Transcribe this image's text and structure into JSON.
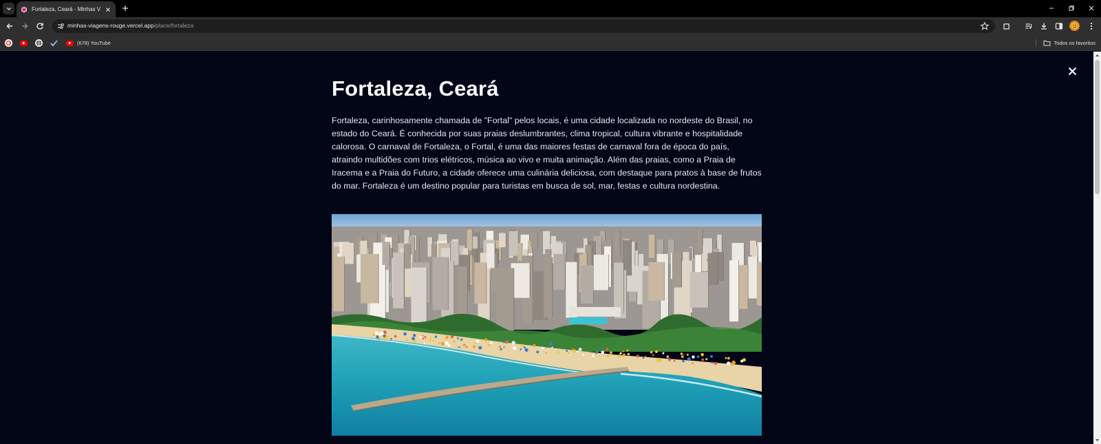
{
  "browser": {
    "tab": {
      "title": "Fortaleza, Ceará - Minhas Viage"
    },
    "url": {
      "host": "minhas-viagens-rouge.vercel.app",
      "path": "/place/fortaleza"
    },
    "bookmarks": {
      "youtube_label": "(678) YouTube",
      "all_bookmarks_label": "Todos os favoritos"
    },
    "colors": {
      "chrome_dark": "#000000",
      "toolbar": "#2f2f2f",
      "omnibox": "#1e1e1e"
    }
  },
  "page": {
    "title": "Fortaleza, Ceará",
    "description": "Fortaleza, carinhosamente chamada de \"Fortal\" pelos locais, é uma cidade localizada no nordeste do Brasil, no estado do Ceará. É conhecida por suas praias deslumbrantes, clima tropical, cultura vibrante e hospitalidade calorosa. O carnaval de Fortaleza, o Fortal, é uma das maiores festas de carnaval fora de época do país, atraindo multidões com trios elétricos, música ao vivo e muita animação. Além das praias, como a Praia de Iracema e a Praia do Futuro, a cidade oferece uma culinária deliciosa, com destaque para pratos à base de frutos do mar. Fortaleza é um destino popular para turistas em busca de sol, mar, festas e cultura nordestina.",
    "colors": {
      "background": "#020617",
      "text": "#e5e7eb",
      "heading": "#f8fafc"
    }
  },
  "icons": {
    "tab_list": "chevron-down-icon",
    "close": "close-icon",
    "back": "arrow-left-icon",
    "forward": "arrow-right-icon",
    "reload": "reload-icon",
    "bookmark": "star-icon"
  }
}
